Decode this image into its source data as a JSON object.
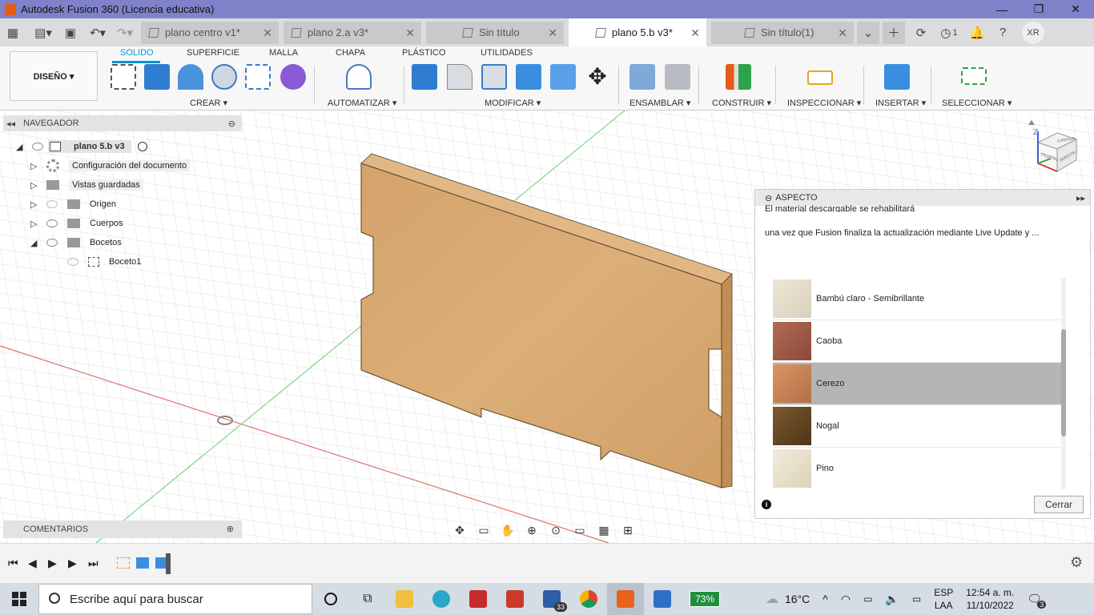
{
  "window": {
    "title": "Autodesk Fusion 360 (Licencia educativa)"
  },
  "tabs": [
    {
      "label": "plano centro v1*"
    },
    {
      "label": "plano 2.a v3*"
    },
    {
      "label": "Sin título"
    },
    {
      "label": "plano 5.b v3*"
    },
    {
      "label": "Sin título(1)"
    }
  ],
  "tabbar": {
    "notif_count": "1",
    "user_initials": "XR"
  },
  "ribbon": {
    "workspace": "DISEÑO ▾",
    "tabs": [
      "SOLIDO",
      "SUPERFICIE",
      "MALLA",
      "CHAPA",
      "PLÁSTICO",
      "UTILIDADES"
    ],
    "groups": [
      "CREAR ▾",
      "AUTOMATIZAR ▾",
      "MODIFICAR ▾",
      "ENSAMBLAR ▾",
      "CONSTRUIR ▾",
      "INSPECCIONAR ▾",
      "INSERTAR ▾",
      "SELECCIONAR ▾"
    ]
  },
  "navigator": {
    "title": "NAVEGADOR",
    "root": "plano 5.b v3",
    "items": [
      {
        "label": "Configuración del documento"
      },
      {
        "label": "Vistas guardadas"
      },
      {
        "label": "Origen"
      },
      {
        "label": "Cuerpos"
      },
      {
        "label": "Bocetos"
      },
      {
        "label": "Boceto1"
      }
    ]
  },
  "comments": {
    "title": "COMENTARIOS"
  },
  "aspect": {
    "title": "ASPECTO",
    "message1": "El material descargable se rehabilitará",
    "message2": "una vez que Fusion finaliza la actualización mediante Live Update y ...",
    "materials": [
      {
        "name": "Bambú claro - Semibrillante",
        "color": "#e6dfcd"
      },
      {
        "name": "Caoba",
        "color": "#a05a48"
      },
      {
        "name": "Cerezo",
        "color": "#c98357",
        "selected": true
      },
      {
        "name": "Nogal",
        "color": "#6a4a26"
      },
      {
        "name": "Pino",
        "color": "#ece5d2"
      }
    ],
    "close_label": "Cerrar"
  },
  "viewcube": {
    "top": "SUPERIOR",
    "front": "FRONTAL",
    "right": "DERECHA"
  },
  "taskbar": {
    "search_placeholder": "Escribe aquí para buscar",
    "mail_badge": "33",
    "battery": "73%",
    "temperature": "16°C",
    "lang1": "ESP",
    "lang2": "LAA",
    "time": "12:54 a. m.",
    "date": "11/10/2022",
    "notif_count": "3"
  }
}
